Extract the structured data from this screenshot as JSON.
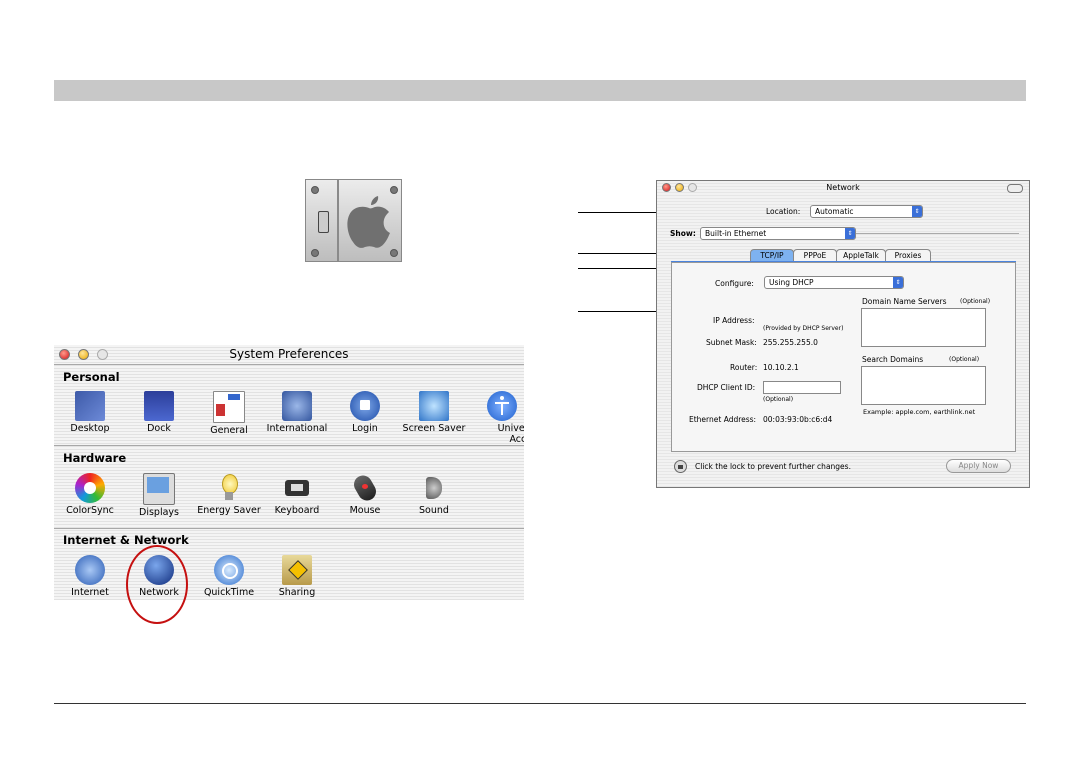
{
  "system_preferences": {
    "title": "System Preferences",
    "sections": [
      {
        "heading": "Personal",
        "items": [
          "Desktop",
          "Dock",
          "General",
          "International",
          "Login",
          "Screen Saver",
          "Universal Access"
        ]
      },
      {
        "heading": "Hardware",
        "items": [
          "ColorSync",
          "Displays",
          "Energy Saver",
          "Keyboard",
          "Mouse",
          "Sound"
        ]
      },
      {
        "heading": "Internet & Network",
        "items": [
          "Internet",
          "Network",
          "QuickTime",
          "Sharing"
        ]
      }
    ],
    "highlighted_item": "Network"
  },
  "network": {
    "title": "Network",
    "location_label": "Location:",
    "location_value": "Automatic",
    "show_label": "Show:",
    "show_value": "Built-in Ethernet",
    "tabs": [
      "TCP/IP",
      "PPPoE",
      "AppleTalk",
      "Proxies"
    ],
    "active_tab": "TCP/IP",
    "configure_label": "Configure:",
    "configure_value": "Using DHCP",
    "ip_address_label": "IP Address:",
    "ip_provided_note": "(Provided by DHCP Server)",
    "subnet_mask_label": "Subnet Mask:",
    "subnet_mask_value": "255.255.255.0",
    "router_label": "Router:",
    "router_value": "10.10.2.1",
    "dhcp_client_id_label": "DHCP Client ID:",
    "dhcp_optional": "(Optional)",
    "ethernet_address_label": "Ethernet Address:",
    "ethernet_address_value": "00:03:93:0b:c6:d4",
    "dns_label": "Domain Name Servers",
    "dns_optional": "(Optional)",
    "search_domains_label": "Search Domains",
    "search_domains_optional": "(Optional)",
    "example_text": "Example: apple.com, earthlink.net",
    "lock_text": "Click the lock to prevent further changes.",
    "apply_button": "Apply Now"
  }
}
